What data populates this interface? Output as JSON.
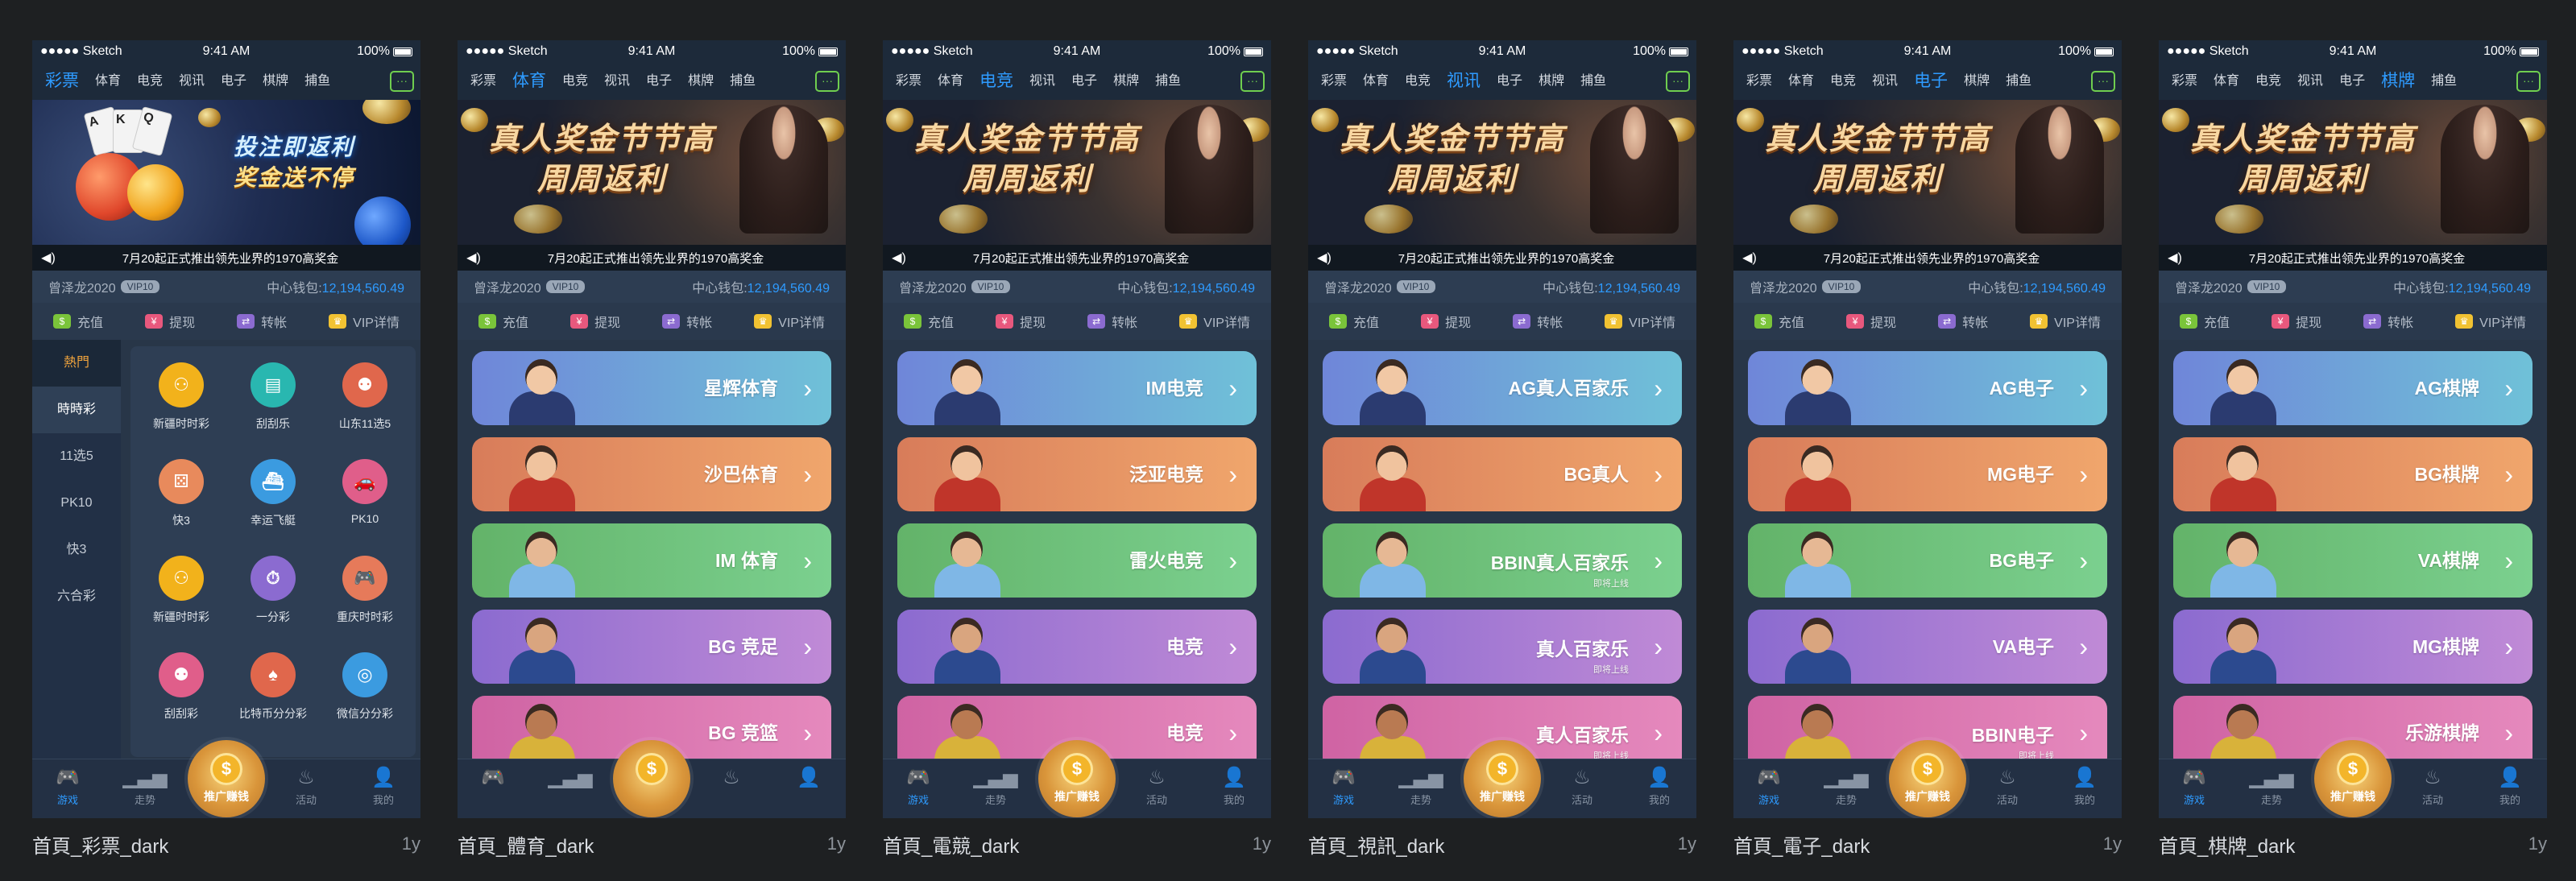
{
  "status": {
    "carrier": "●●●●● Sketch",
    "time": "9:41 AM",
    "battery": "100%"
  },
  "nav": [
    "彩票",
    "体育",
    "电竞",
    "视讯",
    "电子",
    "棋牌",
    "捕鱼"
  ],
  "nav_msg_icon": "chat-icon",
  "banner": {
    "headline1": "真人奖金节节高",
    "headline2": "周周返利",
    "lottery_l1": "投注即返利",
    "lottery_l2": "奖金送不停",
    "marquee": "7月20起正式推出领先业界的1970高奖金"
  },
  "user": {
    "name": "曾泽龙2020",
    "vip": "VIP10",
    "wallet_label": "中心钱包:",
    "amount": "12,194,560.49"
  },
  "actions": [
    {
      "label": "充值",
      "icon": "deposit-icon",
      "color": "#7ac43a",
      "glyph": "$"
    },
    {
      "label": "提现",
      "icon": "withdraw-icon",
      "color": "#e8587d",
      "glyph": "¥"
    },
    {
      "label": "转帐",
      "icon": "transfer-icon",
      "color": "#8b6bd0",
      "glyph": "⇄"
    },
    {
      "label": "VIP详情",
      "icon": "crown-icon",
      "color": "#f1c232",
      "glyph": "♛"
    }
  ],
  "tabbar": {
    "games": "游戏",
    "trend": "走势",
    "promo": "推广赚钱",
    "events": "活动",
    "me": "我的"
  },
  "lottery": {
    "side": [
      "熱門",
      "時時彩",
      "11选5",
      "PK10",
      "快3",
      "六合彩"
    ],
    "grid": [
      {
        "label": "新疆时时彩",
        "color": "#f2b21b",
        "glyph": "⚇"
      },
      {
        "label": "刮刮乐",
        "color": "#29b7b0",
        "glyph": "▤"
      },
      {
        "label": "山东11选5",
        "color": "#e0674c",
        "glyph": "⚉"
      },
      {
        "label": "快3",
        "color": "#e88a5c",
        "glyph": "⚄"
      },
      {
        "label": "幸运飞艇",
        "color": "#3b9be0",
        "glyph": "⛴"
      },
      {
        "label": "PK10",
        "color": "#e05e8a",
        "glyph": "🚗"
      },
      {
        "label": "新疆时时彩",
        "color": "#f2b21b",
        "glyph": "⚇"
      },
      {
        "label": "一分彩",
        "color": "#8b6bd0",
        "glyph": "⏱"
      },
      {
        "label": "重庆时时彩",
        "color": "#e67a5a",
        "glyph": "🎮"
      },
      {
        "label": "刮刮彩",
        "color": "#e05e8a",
        "glyph": "⚉"
      },
      {
        "label": "比特币分分彩",
        "color": "#e0674c",
        "glyph": "♠"
      },
      {
        "label": "微信分分彩",
        "color": "#3b9be0",
        "glyph": "◎"
      }
    ]
  },
  "screens": [
    {
      "title": "首頁_彩票_dark",
      "age": "1y",
      "type": "lottery"
    },
    {
      "title": "首頁_體育_dark",
      "age": "1y",
      "type": "list",
      "items": [
        {
          "label": "星辉体育",
          "sub": ""
        },
        {
          "label": "沙巴体育",
          "sub": ""
        },
        {
          "label": "IM 体育",
          "sub": ""
        },
        {
          "label": "BG 竞足",
          "sub": ""
        },
        {
          "label": "BG 竞篮",
          "sub": ""
        }
      ]
    },
    {
      "title": "首頁_電競_dark",
      "age": "1y",
      "type": "list",
      "items": [
        {
          "label": "IM电竞",
          "sub": ""
        },
        {
          "label": "泛亚电竞",
          "sub": ""
        },
        {
          "label": "雷火电竞",
          "sub": ""
        },
        {
          "label": "电竞",
          "sub": ""
        },
        {
          "label": "电竞",
          "sub": ""
        }
      ]
    },
    {
      "title": "首頁_視訊_dark",
      "age": "1y",
      "type": "list",
      "items": [
        {
          "label": "AG真人百家乐",
          "sub": ""
        },
        {
          "label": "BG真人",
          "sub": ""
        },
        {
          "label": "BBIN真人百家乐",
          "sub": "即将上线"
        },
        {
          "label": "真人百家乐",
          "sub": "即将上线"
        },
        {
          "label": "真人百家乐",
          "sub": "即将上线"
        }
      ]
    },
    {
      "title": "首頁_電子_dark",
      "age": "1y",
      "type": "list",
      "items": [
        {
          "label": "AG电子",
          "sub": ""
        },
        {
          "label": "MG电子",
          "sub": ""
        },
        {
          "label": "BG电子",
          "sub": ""
        },
        {
          "label": "VA电子",
          "sub": ""
        },
        {
          "label": "BBIN电子",
          "sub": "即将上线"
        }
      ]
    },
    {
      "title": "首頁_棋牌_dark",
      "age": "1y",
      "type": "list",
      "items": [
        {
          "label": "AG棋牌",
          "sub": ""
        },
        {
          "label": "BG棋牌",
          "sub": ""
        },
        {
          "label": "VA棋牌",
          "sub": ""
        },
        {
          "label": "MG棋牌",
          "sub": ""
        },
        {
          "label": "乐游棋牌",
          "sub": ""
        }
      ]
    }
  ]
}
